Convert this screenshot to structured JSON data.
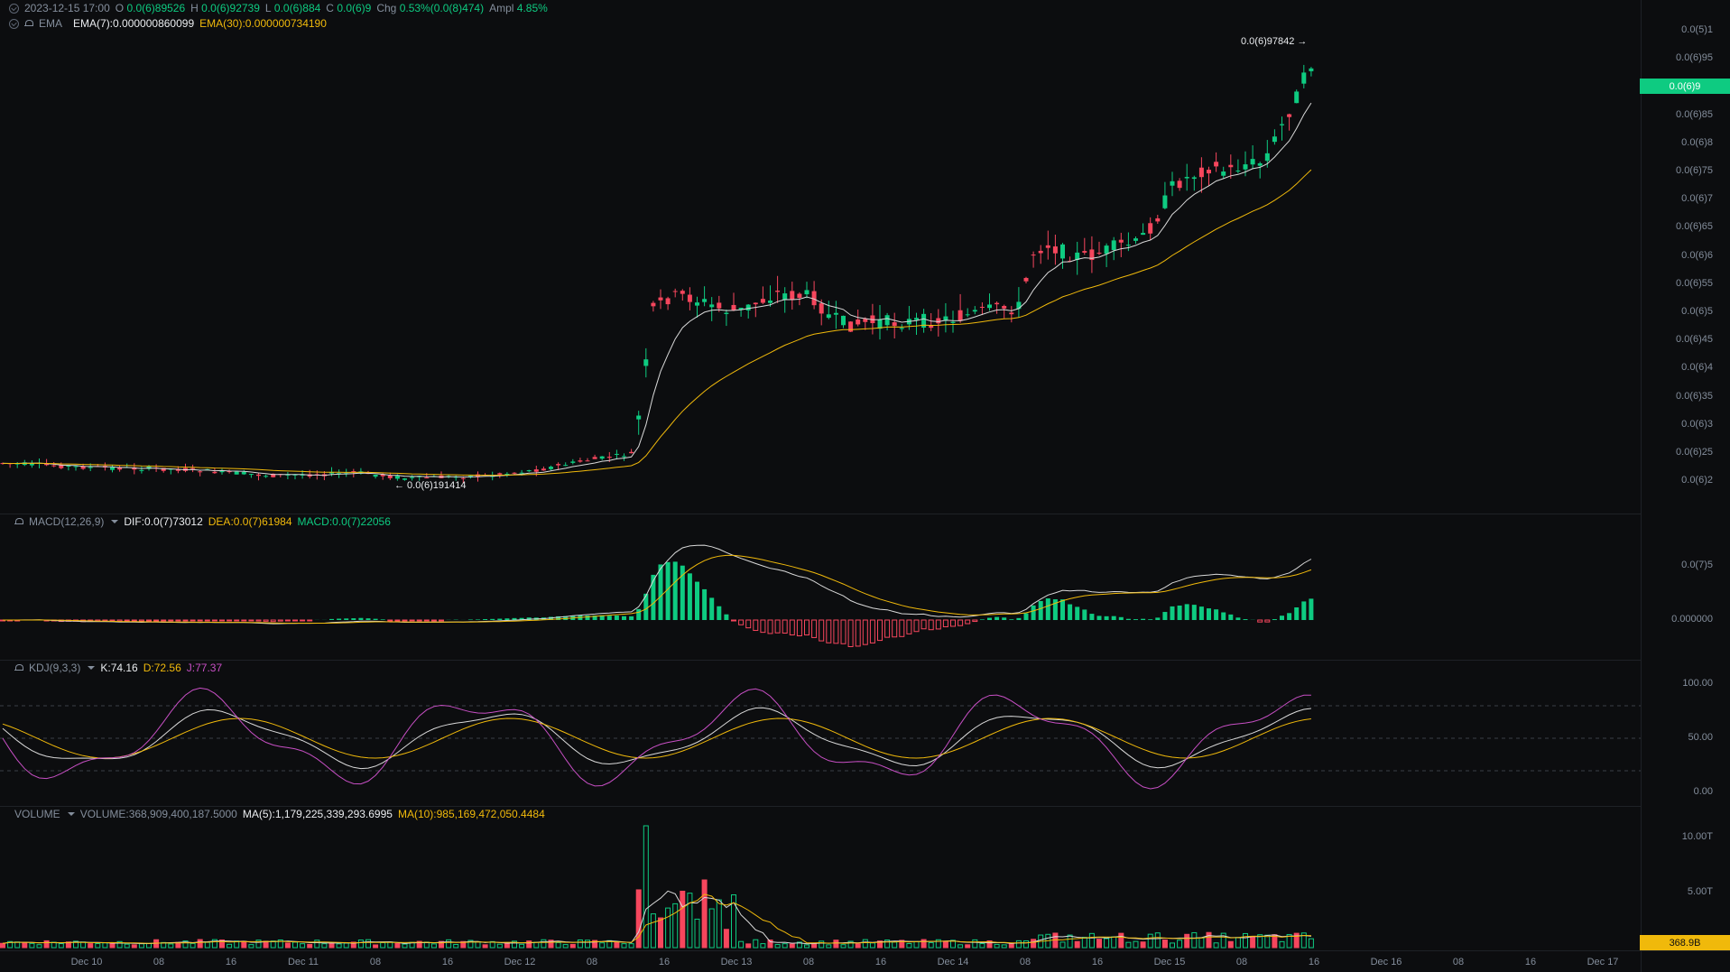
{
  "header": {
    "datetime": "2023-12-15 17:00",
    "open_label": "O",
    "open": "0.0(6)89526",
    "high_label": "H",
    "high": "0.0(6)92739",
    "low_label": "L",
    "low": "0.0(6)884",
    "close_label": "C",
    "close": "0.0(6)9",
    "chg_label": "Chg",
    "chg": "0.53%(0.0(8)474)",
    "ampl_label": "Ampl",
    "ampl": "4.85%"
  },
  "ema": {
    "name": "EMA",
    "ema7": "EMA(7):0.000000860099",
    "ema30": "EMA(30):0.000000734190"
  },
  "macd": {
    "name": "MACD(12,26,9)",
    "dif": "DIF:0.0(7)73012",
    "dea": "DEA:0.0(7)61984",
    "macd": "MACD:0.0(7)22056"
  },
  "kdj": {
    "name": "KDJ(9,3,3)",
    "k": "K:74.16",
    "d": "D:72.56",
    "j": "J:77.37"
  },
  "volume": {
    "name": "VOLUME",
    "vol": "VOLUME:368,909,400,187.5000",
    "ma5": "MA(5):1,179,225,339,293.6995",
    "ma10": "MA(10):985,169,472,050.4484"
  },
  "annotations": {
    "high_mark": "0.0(6)97842 →",
    "low_mark": "← 0.0(6)191414"
  },
  "price_axis": [
    "0.0(5)1",
    "0.0(6)95",
    "0.0(6)9",
    "0.0(6)85",
    "0.0(6)8",
    "0.0(6)75",
    "0.0(6)7",
    "0.0(6)65",
    "0.0(6)6",
    "0.0(6)55",
    "0.0(6)5",
    "0.0(6)45",
    "0.0(6)4",
    "0.0(6)35",
    "0.0(6)3",
    "0.0(6)25",
    "0.0(6)2"
  ],
  "price_tag": "0.0(6)9",
  "macd_axis": [
    "0.0(7)5",
    "0.000000"
  ],
  "kdj_axis": [
    "100.00",
    "50.00",
    "0.00"
  ],
  "volume_axis": [
    "10.00T",
    "5.00T"
  ],
  "volume_tag": "368.9B",
  "time_axis": [
    "Dec 10",
    "08",
    "16",
    "Dec 11",
    "08",
    "16",
    "Dec 12",
    "08",
    "16",
    "Dec 13",
    "08",
    "16",
    "Dec 14",
    "08",
    "16",
    "Dec 15",
    "08",
    "16",
    "Dec 16",
    "08",
    "16",
    "Dec 17"
  ],
  "colors": {
    "up": "#0ecb81",
    "down": "#f6465d",
    "ema7": "#d9d9d9",
    "ema30": "#f0b90b",
    "j": "#c74fc4",
    "bg": "#0c0d0f"
  }
}
